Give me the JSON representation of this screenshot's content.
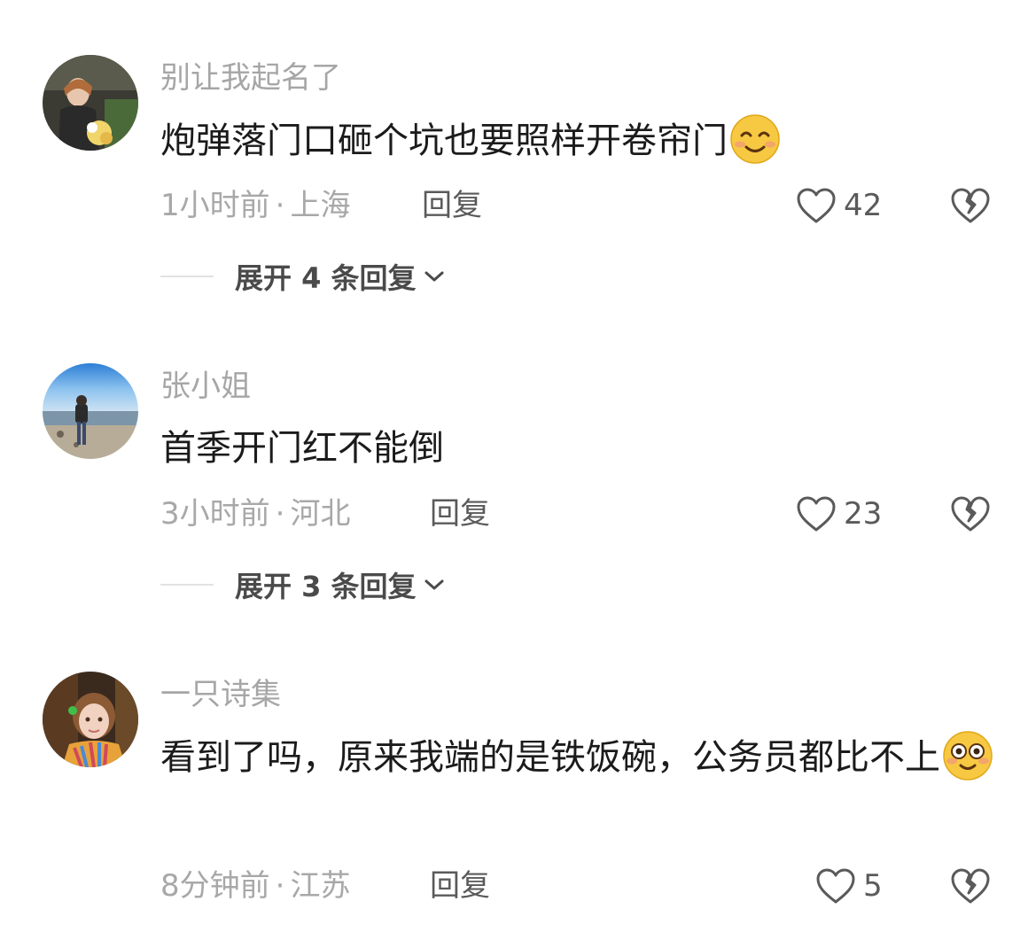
{
  "comments": [
    {
      "username": "别让我起名了",
      "text": "炮弹落门口砸个坑也要照样开卷帘门",
      "emoji": "smiling-face-emoji",
      "time": "1小时前",
      "location": "上海",
      "reply_label": "回复",
      "likes": "42",
      "expand_label": "展开 4 条回复"
    },
    {
      "username": "张小姐",
      "text": "首季开门红不能倒",
      "time": "3小时前",
      "location": "河北",
      "reply_label": "回复",
      "likes": "23",
      "expand_label": "展开 3 条回复"
    },
    {
      "username": "一只诗集",
      "text": "看到了吗，原来我端的是铁饭碗，公务员都比不上",
      "emoji": "flushed-face-emoji",
      "time": "8分钟前",
      "location": "江苏",
      "reply_label": "回复",
      "likes": "5"
    }
  ],
  "icons": {
    "like": "heart-outline-icon",
    "dislike": "broken-heart-icon",
    "expand": "chevron-down-icon"
  },
  "colors": {
    "username": "#a6a6a6",
    "text": "#1b1b1b",
    "meta": "#a8a8a8",
    "action": "#5a5a5a",
    "emoji_yellow": "#f7c842"
  }
}
